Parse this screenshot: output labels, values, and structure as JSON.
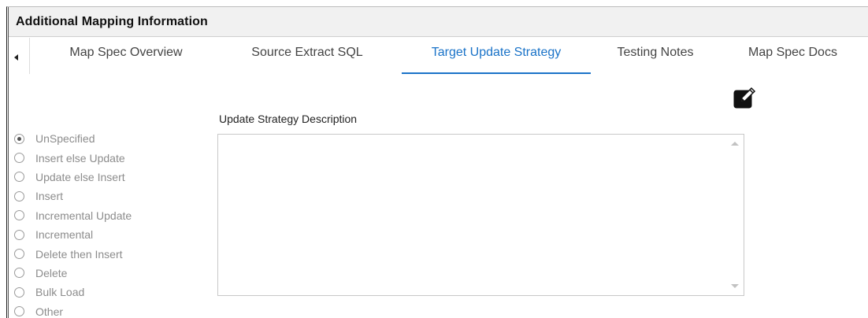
{
  "panel": {
    "title": "Additional Mapping Information"
  },
  "tabs": {
    "items": [
      {
        "label": "Map Spec Overview",
        "active": false
      },
      {
        "label": "Source Extract SQL",
        "active": false
      },
      {
        "label": "Target Update Strategy",
        "active": true
      },
      {
        "label": "Testing Notes",
        "active": false
      },
      {
        "label": "Map Spec Docs",
        "active": false
      }
    ],
    "scroll_icon": "caret-left-icon"
  },
  "toolbar": {
    "edit_icon": "pencil-edit-icon"
  },
  "strategy": {
    "selected": "UnSpecified",
    "options": [
      {
        "label": "UnSpecified",
        "checked": true
      },
      {
        "label": "Insert else Update",
        "checked": false
      },
      {
        "label": "Update else Insert",
        "checked": false
      },
      {
        "label": "Insert",
        "checked": false
      },
      {
        "label": "Incremental Update",
        "checked": false
      },
      {
        "label": "Incremental",
        "checked": false
      },
      {
        "label": "Delete then Insert",
        "checked": false
      },
      {
        "label": "Delete",
        "checked": false
      },
      {
        "label": "Bulk Load",
        "checked": false
      },
      {
        "label": "Other",
        "checked": false
      }
    ]
  },
  "description": {
    "label": "Update Strategy Description",
    "value": ""
  },
  "colors": {
    "accent": "#1a73c8",
    "header_bg": "#f1f1f1",
    "muted_text": "#8c8c8c"
  }
}
